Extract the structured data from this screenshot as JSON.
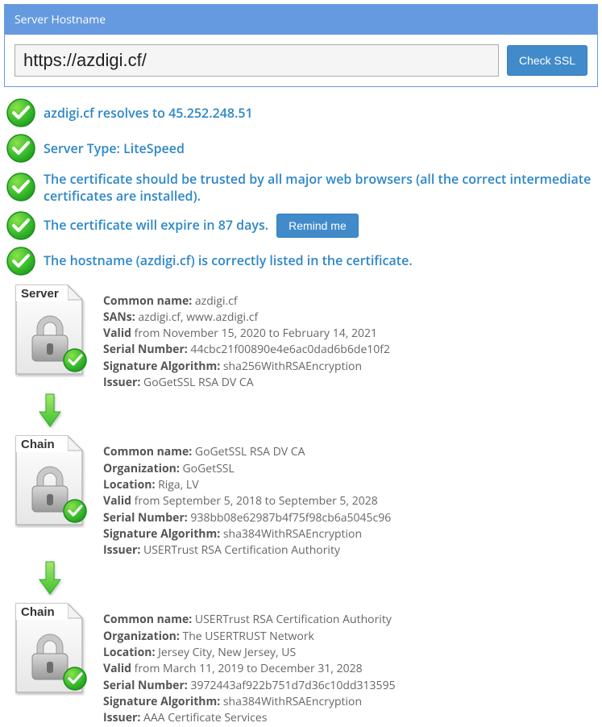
{
  "panel": {
    "title": "Server Hostname",
    "url_value": "https://azdigi.cf/",
    "check_button": "Check SSL"
  },
  "checks": {
    "resolve": "azdigi.cf resolves to 45.252.248.51",
    "server_type": "Server Type: LiteSpeed",
    "trusted": "The certificate should be trusted by all major web browsers (all the correct intermediate certificates are installed).",
    "expire": "The certificate will expire in 87 days.",
    "remind_btn": "Remind me",
    "hostname": "The hostname (azdigi.cf) is correctly listed in the certificate."
  },
  "certs": [
    {
      "badge": "Server",
      "fields": [
        {
          "label": "Common name:",
          "value": " azdigi.cf"
        },
        {
          "label": "SANs:",
          "value": " azdigi.cf, www.azdigi.cf"
        },
        {
          "label": "Valid",
          "value": " from November 15, 2020 to February 14, 2021"
        },
        {
          "label": "Serial Number:",
          "value": " 44cbc21f00890e4e6ac0dad6b6de10f2"
        },
        {
          "label": "Signature Algorithm:",
          "value": " sha256WithRSAEncryption"
        },
        {
          "label": "Issuer:",
          "value": " GoGetSSL RSA DV CA"
        }
      ]
    },
    {
      "badge": "Chain",
      "fields": [
        {
          "label": "Common name:",
          "value": " GoGetSSL RSA DV CA"
        },
        {
          "label": "Organization:",
          "value": " GoGetSSL"
        },
        {
          "label": "Location:",
          "value": " Riga, LV"
        },
        {
          "label": "Valid",
          "value": " from September 5, 2018 to September 5, 2028"
        },
        {
          "label": "Serial Number:",
          "value": " 938bb08e62987b4f75f98cb6a5045c96"
        },
        {
          "label": "Signature Algorithm:",
          "value": " sha384WithRSAEncryption"
        },
        {
          "label": "Issuer:",
          "value": " USERTrust RSA Certification Authority"
        }
      ]
    },
    {
      "badge": "Chain",
      "fields": [
        {
          "label": "Common name:",
          "value": " USERTrust RSA Certification Authority"
        },
        {
          "label": "Organization:",
          "value": " The USERTRUST Network"
        },
        {
          "label": "Location:",
          "value": " Jersey City, New Jersey, US"
        },
        {
          "label": "Valid",
          "value": " from March 11, 2019 to December 31, 2028"
        },
        {
          "label": "Serial Number:",
          "value": " 3972443af922b751d7d36c10dd313595"
        },
        {
          "label": "Signature Algorithm:",
          "value": " sha384WithRSAEncryption"
        },
        {
          "label": "Issuer:",
          "value": " AAA Certificate Services"
        }
      ]
    }
  ]
}
